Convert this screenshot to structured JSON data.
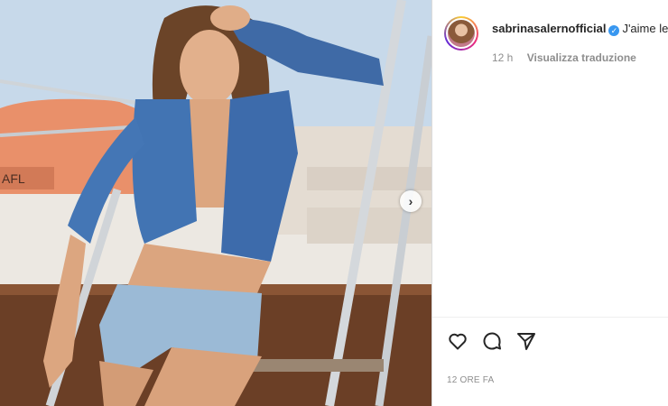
{
  "post": {
    "image_alt": "Woman in denim shirt and denim shorts posing on boat stairs",
    "next_icon": "chevron-right-icon"
  },
  "panel": {
    "username": "sabrinasalernofficial",
    "verified_icon": "verified-badge-icon",
    "caption_text": "J'aime le",
    "time_ago": "12 h",
    "translate_label": "Visualizza traduzione",
    "actions": [
      "heart-icon",
      "comment-icon",
      "share-icon"
    ],
    "date_label": "12 ORE FA"
  },
  "colors": {
    "verified": "#3897f0",
    "text": "#262626",
    "muted": "#8e8e8e"
  }
}
